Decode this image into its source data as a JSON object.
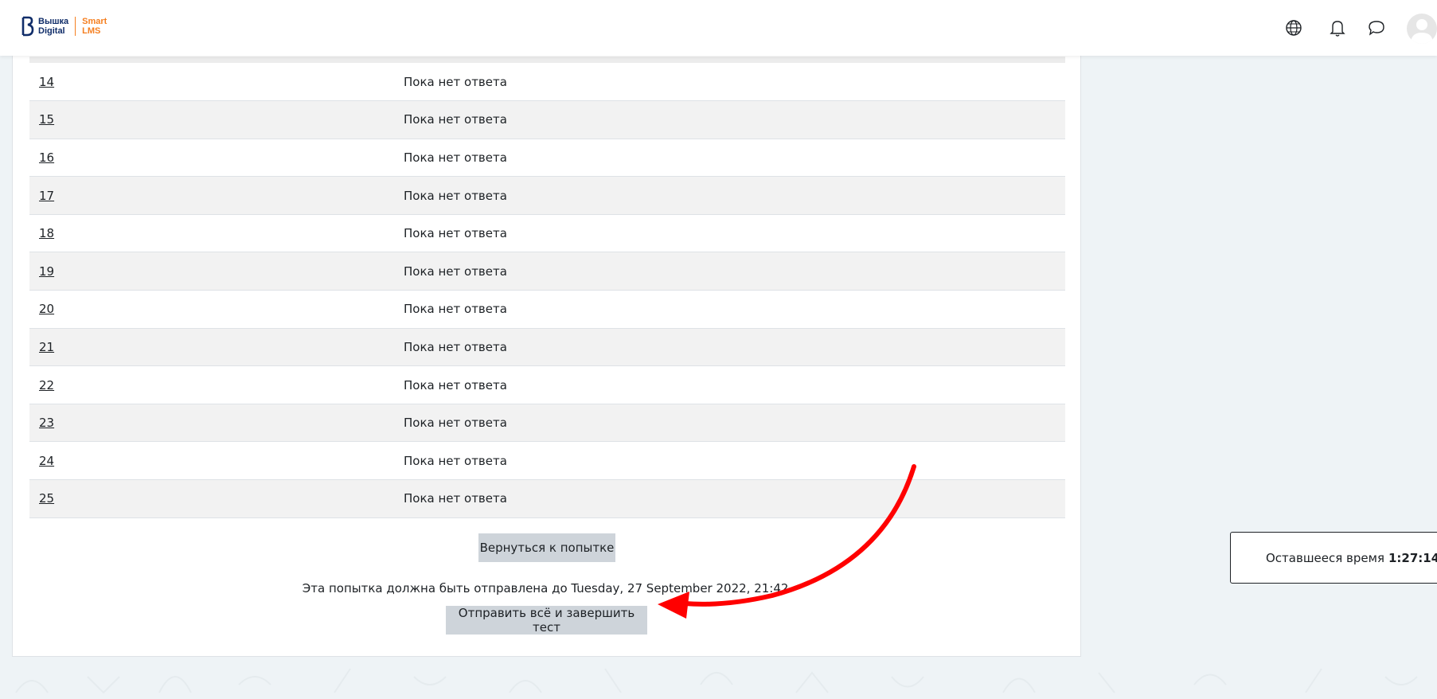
{
  "header": {
    "logo": {
      "line1": "Вышка",
      "line2": "Digital",
      "brand1": "Smart",
      "brand2": "LMS"
    },
    "icons": [
      "globe-icon",
      "bell-icon",
      "chat-icon",
      "avatar"
    ]
  },
  "summary": {
    "rows": [
      {
        "num": "14",
        "status": "Пока нет ответа"
      },
      {
        "num": "15",
        "status": "Пока нет ответа"
      },
      {
        "num": "16",
        "status": "Пока нет ответа"
      },
      {
        "num": "17",
        "status": "Пока нет ответа"
      },
      {
        "num": "18",
        "status": "Пока нет ответа"
      },
      {
        "num": "19",
        "status": "Пока нет ответа"
      },
      {
        "num": "20",
        "status": "Пока нет ответа"
      },
      {
        "num": "21",
        "status": "Пока нет ответа"
      },
      {
        "num": "22",
        "status": "Пока нет ответа"
      },
      {
        "num": "23",
        "status": "Пока нет ответа"
      },
      {
        "num": "24",
        "status": "Пока нет ответа"
      },
      {
        "num": "25",
        "status": "Пока нет ответа"
      }
    ],
    "return_button": "Вернуться к попытке",
    "deadline_text": "Эта попытка должна быть отправлена до Tuesday, 27 September 2022, 21:42.",
    "submit_button": "Отправить всё и завершить тест"
  },
  "timer": {
    "label": "Оставшееся время",
    "value": "1:27:14"
  },
  "colors": {
    "accent_orange": "#f57f20",
    "brand_blue": "#102d69",
    "arrow_red": "#ff0000",
    "button_gray": "#ced4da"
  }
}
